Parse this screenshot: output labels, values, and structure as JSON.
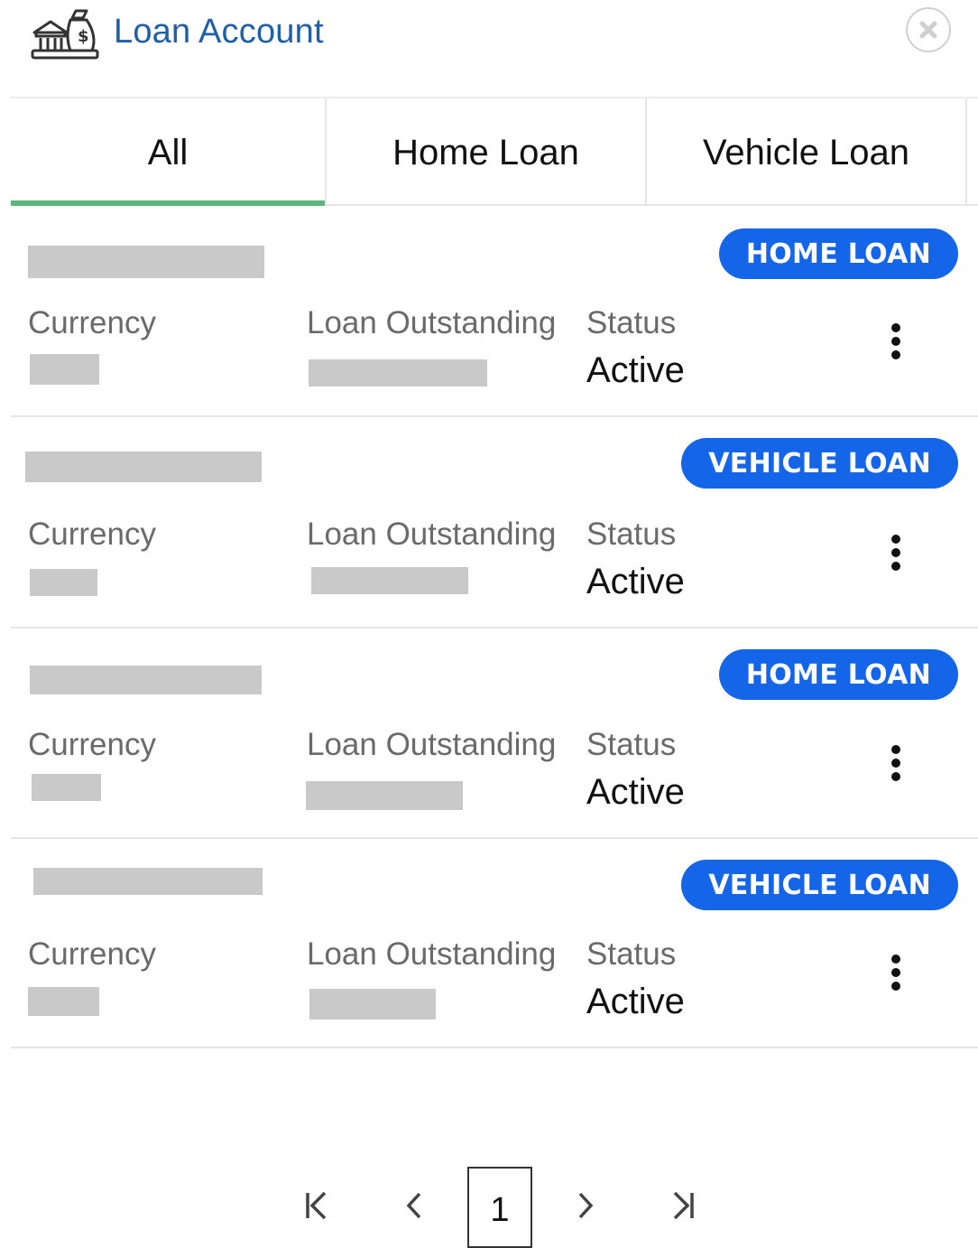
{
  "header": {
    "title": "Loan Account",
    "app_icon": "bank-money-bag-icon",
    "close_icon": "close-circle-icon"
  },
  "tabs": [
    {
      "label": "All",
      "active": true
    },
    {
      "label": "Home Loan",
      "active": false
    },
    {
      "label": "Vehicle Loan",
      "active": false
    }
  ],
  "labels": {
    "currency": "Currency",
    "loan_outstanding": "Loan Outstanding",
    "status": "Status"
  },
  "loans": [
    {
      "badge": "HOME LOAN",
      "status": "Active"
    },
    {
      "badge": "VEHICLE LOAN",
      "status": "Active"
    },
    {
      "badge": "HOME LOAN",
      "status": "Active"
    },
    {
      "badge": "VEHICLE LOAN",
      "status": "Active"
    }
  ],
  "pagination": {
    "current_page": "1",
    "first_icon": "first-page-icon",
    "prev_icon": "chevron-left-icon",
    "next_icon": "chevron-right-icon",
    "last_icon": "last-page-icon"
  },
  "colors": {
    "accent_blue": "#1565e8",
    "title_blue": "#1e5fa8",
    "tab_underline": "#5cb87a",
    "redaction": "#c9c9c9"
  }
}
